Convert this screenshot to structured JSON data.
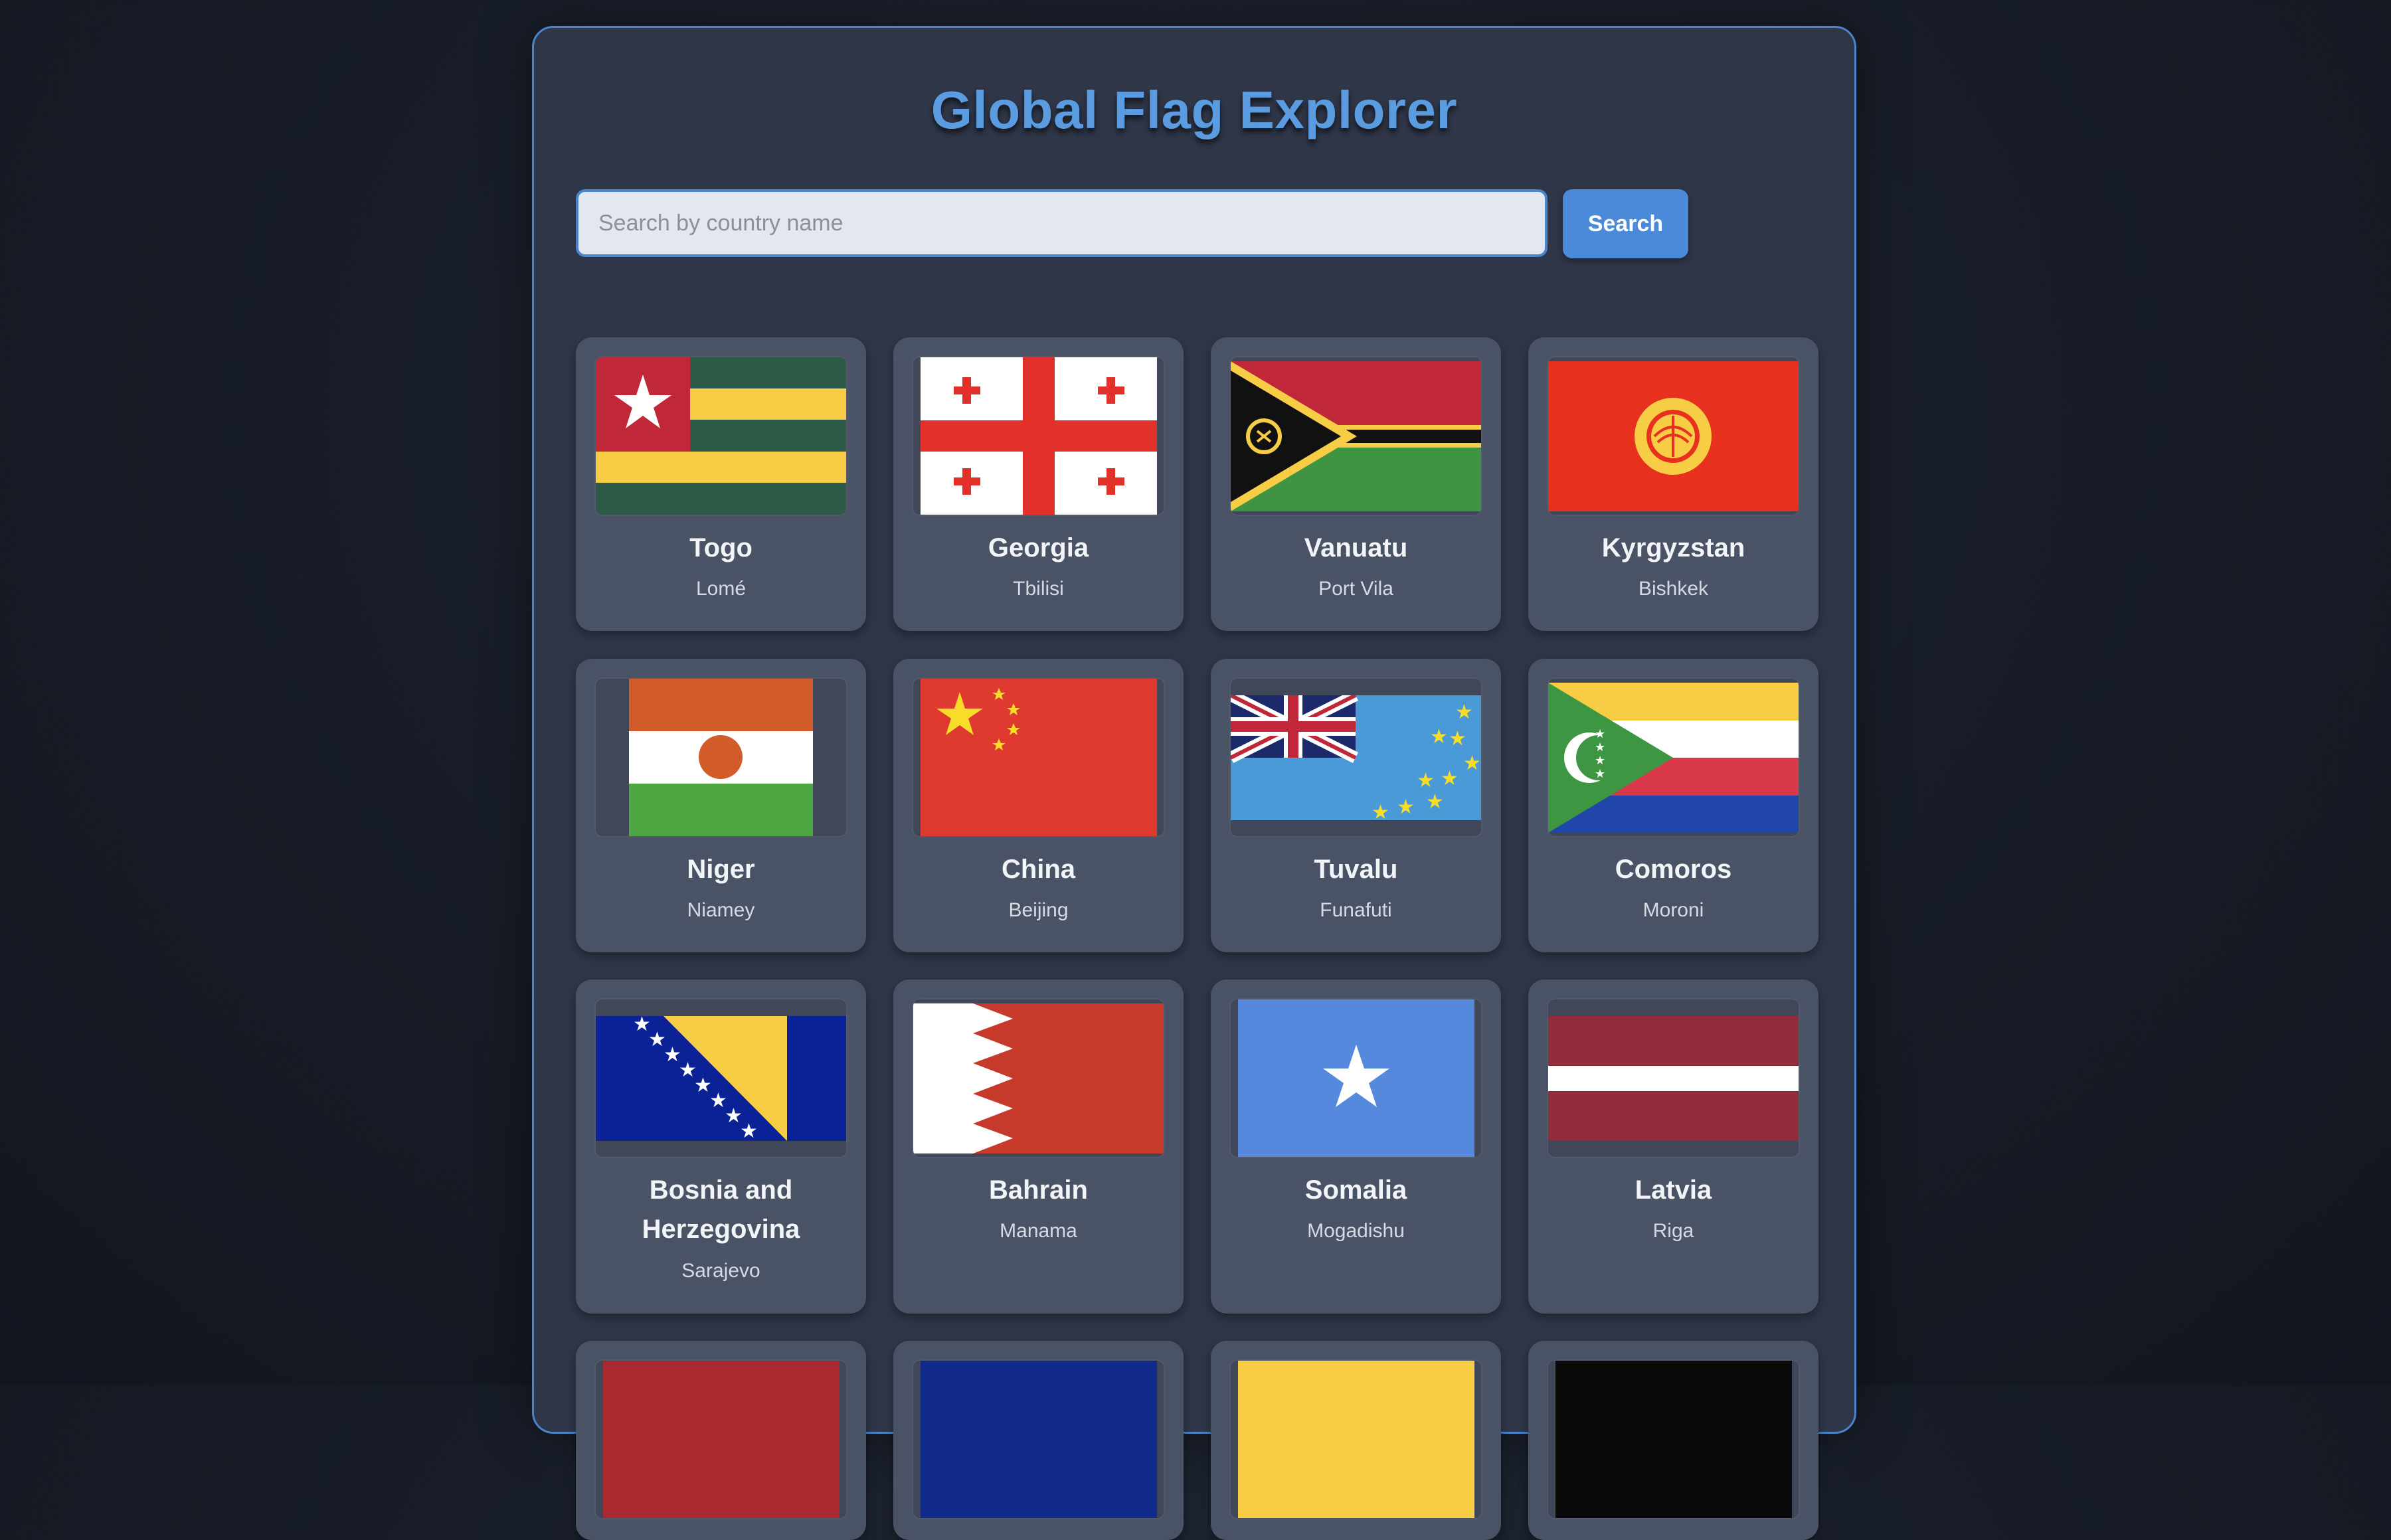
{
  "app": {
    "title": "Global Flag Explorer"
  },
  "search": {
    "placeholder": "Search by country name",
    "value": "",
    "button_label": "Search"
  },
  "countries": [
    {
      "name": "Togo",
      "capital": "Lomé",
      "flag": "togo-flag"
    },
    {
      "name": "Georgia",
      "capital": "Tbilisi",
      "flag": "georgia-flag"
    },
    {
      "name": "Vanuatu",
      "capital": "Port Vila",
      "flag": "vanuatu-flag"
    },
    {
      "name": "Kyrgyzstan",
      "capital": "Bishkek",
      "flag": "kyrgyzstan-flag"
    },
    {
      "name": "Niger",
      "capital": "Niamey",
      "flag": "niger-flag"
    },
    {
      "name": "China",
      "capital": "Beijing",
      "flag": "china-flag"
    },
    {
      "name": "Tuvalu",
      "capital": "Funafuti",
      "flag": "tuvalu-flag"
    },
    {
      "name": "Comoros",
      "capital": "Moroni",
      "flag": "comoros-flag"
    },
    {
      "name": "Bosnia and Herzegovina",
      "capital": "Sarajevo",
      "flag": "bosnia-flag"
    },
    {
      "name": "Bahrain",
      "capital": "Manama",
      "flag": "bahrain-flag"
    },
    {
      "name": "Somalia",
      "capital": "Mogadishu",
      "flag": "somalia-flag"
    },
    {
      "name": "Latvia",
      "capital": "Riga",
      "flag": "latvia-flag"
    }
  ],
  "colors": {
    "accent": "#4a84c9",
    "title": "#5b9be0",
    "panel": "#2f3647",
    "card": "#4a5365"
  }
}
